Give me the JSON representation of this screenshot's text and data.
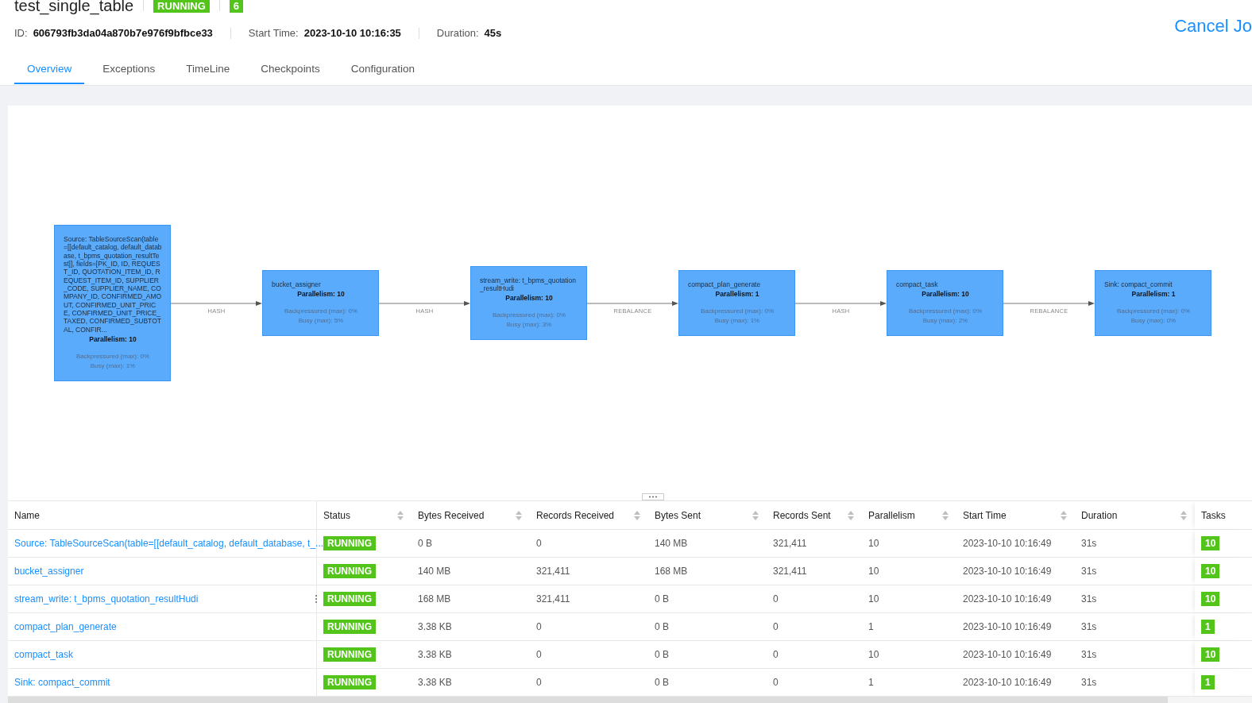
{
  "job": {
    "title": "test_single_table",
    "status": "RUNNING",
    "count": "6",
    "id_label": "ID:",
    "id": "606793fb3da04a870b7e976f9bfbce33",
    "start_label": "Start Time:",
    "start": "2023-10-10 10:16:35",
    "duration_label": "Duration:",
    "duration": "45s",
    "cancel": "Cancel Jo"
  },
  "tabs": [
    {
      "label": "Overview",
      "selected": true
    },
    {
      "label": "Exceptions",
      "selected": false
    },
    {
      "label": "TimeLine",
      "selected": false
    },
    {
      "label": "Checkpoints",
      "selected": false
    },
    {
      "label": "Configuration",
      "selected": false
    }
  ],
  "graph": {
    "nodes": [
      {
        "name": "Source: TableSourceScan(table=[[default_catalog, default_database, t_bpms_quotation_resultTest]], fields=[PK_ID, ID, REQUEST_ID, QUOTATION_ITEM_ID, REQUEST_ITEM_ID, SUPPLIER_CODE, SUPPLIER_NAME, COMPANY_ID, CONFIRMED_AMOUT, CONFIRMED_UNIT_PRICE, CONFIRMED_UNIT_PRICE_TAXED, CONFIRMED_SUBTOTAL, CONFIR...",
        "parallelism": "Parallelism: 10",
        "backpressured": "Backpressured (max): 0%",
        "busy": "Busy (max): 1%"
      },
      {
        "name": "bucket_assigner",
        "parallelism": "Parallelism: 10",
        "backpressured": "Backpressured (max): 0%",
        "busy": "Busy (max): 5%"
      },
      {
        "name": "stream_write: t_bpms_quotation_resultHudi",
        "parallelism": "Parallelism: 10",
        "backpressured": "Backpressured (max): 0%",
        "busy": "Busy (max): 3%"
      },
      {
        "name": "compact_plan_generate",
        "parallelism": "Parallelism: 1",
        "backpressured": "Backpressured (max): 0%",
        "busy": "Busy (max): 1%"
      },
      {
        "name": "compact_task",
        "parallelism": "Parallelism: 10",
        "backpressured": "Backpressured (max): 0%",
        "busy": "Busy (max): 2%"
      },
      {
        "name": "Sink: compact_commit",
        "parallelism": "Parallelism: 1",
        "backpressured": "Backpressured (max): 0%",
        "busy": "Busy (max): 0%"
      }
    ],
    "edges": [
      "HASH",
      "HASH",
      "REBALANCE",
      "HASH",
      "REBALANCE"
    ]
  },
  "table": {
    "columns": [
      {
        "label": "Name",
        "sortable": false,
        "kind": "link"
      },
      {
        "label": "Status",
        "sortable": true,
        "kind": "status"
      },
      {
        "label": "Bytes Received",
        "sortable": true,
        "kind": "text"
      },
      {
        "label": "Records Received",
        "sortable": true,
        "kind": "text"
      },
      {
        "label": "Bytes Sent",
        "sortable": true,
        "kind": "text"
      },
      {
        "label": "Records Sent",
        "sortable": true,
        "kind": "text"
      },
      {
        "label": "Parallelism",
        "sortable": true,
        "kind": "text"
      },
      {
        "label": "Start Time",
        "sortable": true,
        "kind": "text"
      },
      {
        "label": "Duration",
        "sortable": true,
        "kind": "text"
      },
      {
        "label": "Tasks",
        "sortable": false,
        "kind": "badge"
      }
    ],
    "rows": [
      [
        "Source: TableSourceScan(table=[[default_catalog, default_database, t_...",
        "RUNNING",
        "0 B",
        "0",
        "140 MB",
        "321,411",
        "10",
        "2023-10-10 10:16:49",
        "31s",
        "10"
      ],
      [
        "bucket_assigner",
        "RUNNING",
        "140 MB",
        "321,411",
        "168 MB",
        "321,411",
        "10",
        "2023-10-10 10:16:49",
        "31s",
        "10"
      ],
      [
        "stream_write: t_bpms_quotation_resultHudi",
        "RUNNING",
        "168 MB",
        "321,411",
        "0 B",
        "0",
        "10",
        "2023-10-10 10:16:49",
        "31s",
        "10"
      ],
      [
        "compact_plan_generate",
        "RUNNING",
        "3.38 KB",
        "0",
        "0 B",
        "0",
        "1",
        "2023-10-10 10:16:49",
        "31s",
        "1"
      ],
      [
        "compact_task",
        "RUNNING",
        "3.38 KB",
        "0",
        "0 B",
        "0",
        "10",
        "2023-10-10 10:16:49",
        "31s",
        "10"
      ],
      [
        "Sink: compact_commit",
        "RUNNING",
        "3.38 KB",
        "0",
        "0 B",
        "0",
        "1",
        "2023-10-10 10:16:49",
        "31s",
        "1"
      ]
    ]
  }
}
